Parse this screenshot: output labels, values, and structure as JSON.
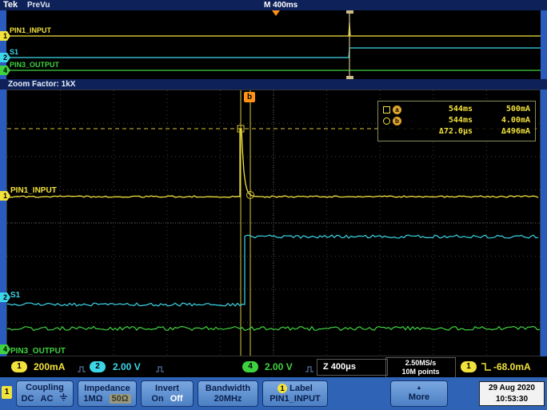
{
  "header": {
    "brand": "Tek",
    "mode": "PreVu",
    "main_timebase": "M 400ms"
  },
  "traces": {
    "ch1": {
      "badge": "1",
      "label": "PIN1_INPUT",
      "color": "#f2e23c"
    },
    "ch2": {
      "badge": "2",
      "label": "S1",
      "color": "#3cd6e8"
    },
    "ch4": {
      "badge": "4",
      "label": "PIN3_OUTPUT",
      "color": "#3fd23f"
    }
  },
  "zoom": {
    "factor_label": "Zoom Factor: 1kX",
    "b_tag": "b"
  },
  "cursors": {
    "a": {
      "letter": "a",
      "time": "544ms",
      "value": "500mA"
    },
    "b": {
      "letter": "b",
      "time": "544ms",
      "value": "4.00mA"
    },
    "delta_time": "Δ72.0μs",
    "delta_value": "Δ496mA"
  },
  "status": {
    "ch1_scale": "200mA",
    "ch2_scale": "2.00 V",
    "ch4_scale": "2.00 V",
    "zoom_timebase": "Z 400μs",
    "sample_rate": "2.50MS/s",
    "record_length": "10M points",
    "trigger_channel": "1",
    "trigger_level": "-68.0mA"
  },
  "menu": {
    "channel_tab": "1",
    "coupling": {
      "title": "Coupling",
      "opt_dc": "DC",
      "opt_ac": "AC"
    },
    "impedance": {
      "title": "Impedance",
      "opt_1m": "1MΩ",
      "opt_50": "50Ω"
    },
    "invert": {
      "title": "Invert",
      "opt_on": "On",
      "opt_off": "Off"
    },
    "bandwidth": {
      "title": "Bandwidth",
      "value": "20MHz"
    },
    "label_btn": {
      "badge": "1",
      "title": "Label",
      "value": "PIN1_INPUT"
    },
    "more": {
      "arrow": "▲",
      "title": "More"
    },
    "datetime": {
      "date": "29 Aug 2020",
      "time": "10:53:30"
    }
  }
}
